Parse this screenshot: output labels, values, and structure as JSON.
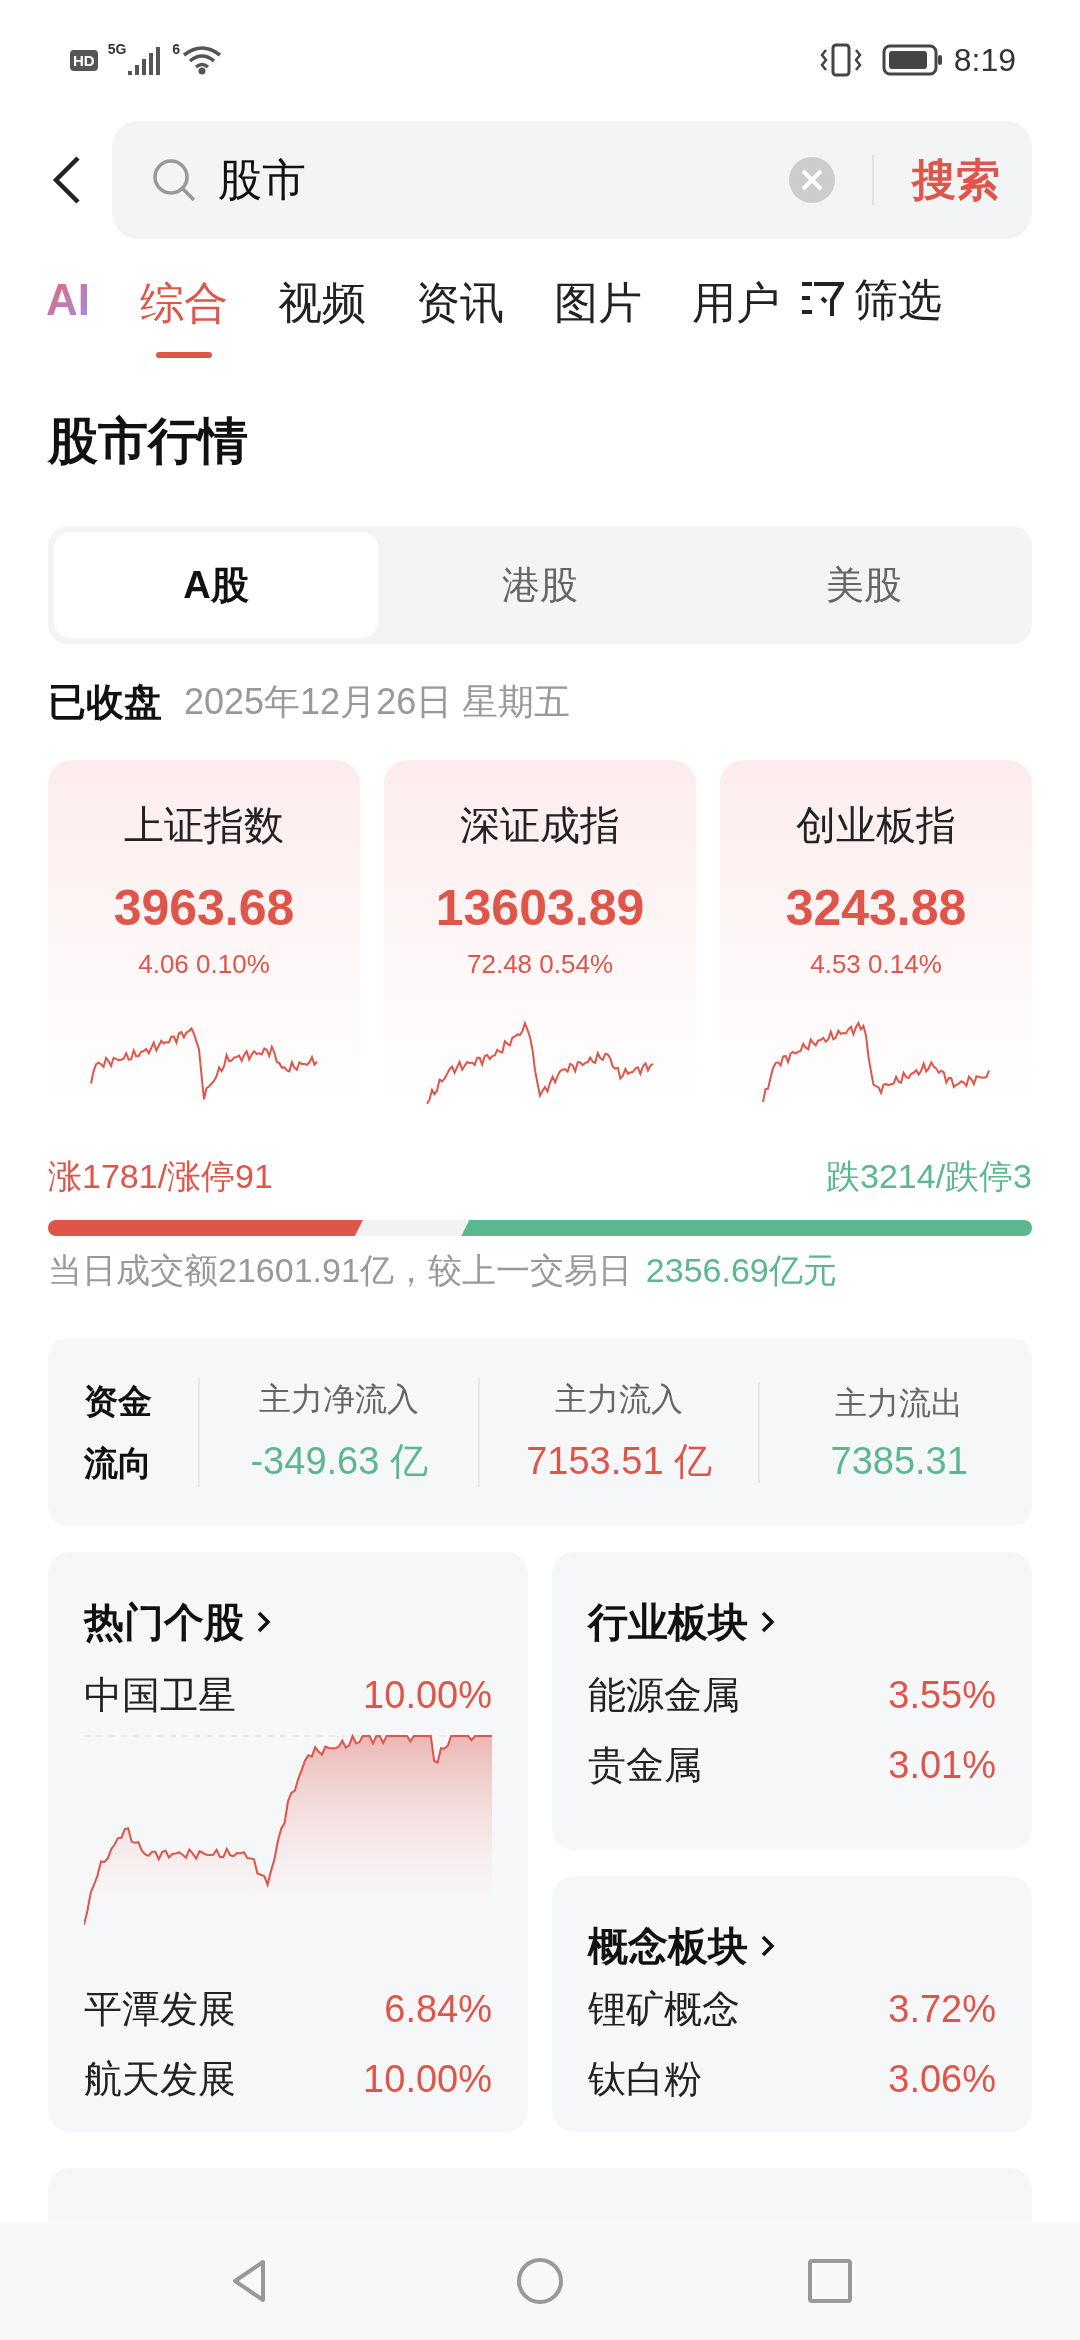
{
  "status_bar": {
    "hd": "HD",
    "network": "5G",
    "wifi_gen": "6",
    "time": "8:19"
  },
  "search": {
    "value": "股市",
    "button": "搜索"
  },
  "ai_label": "AI",
  "tabs": [
    {
      "label": "综合",
      "selected": true
    },
    {
      "label": "视频",
      "selected": false
    },
    {
      "label": "资讯",
      "selected": false
    },
    {
      "label": "图片",
      "selected": false
    },
    {
      "label": "用户",
      "selected": false
    }
  ],
  "filter": "筛选",
  "section_title": "股市行情",
  "markets": [
    {
      "label": "A股",
      "selected": true
    },
    {
      "label": "港股",
      "selected": false
    },
    {
      "label": "美股",
      "selected": false
    }
  ],
  "market_status": "已收盘",
  "date": "2025年12月26日 星期五",
  "indices": [
    {
      "name": "上证指数",
      "value": "3963.68",
      "change": "4.06 0.10%"
    },
    {
      "name": "深证成指",
      "value": "13603.89",
      "change": "72.48 0.54%"
    },
    {
      "name": "创业板指",
      "value": "3243.88",
      "change": "4.53 0.14%"
    }
  ],
  "breadth": {
    "up_text": "涨1781/涨停91",
    "down_text": "跌3214/跌停3",
    "up": {
      "level": 0.32
    },
    "down": {
      "level": 0.58
    }
  },
  "turnover": {
    "text": "当日成交额21601.91亿，较上一交易日",
    "delta": "2356.69亿元"
  },
  "fund_flow": {
    "title": "资金流向",
    "columns": [
      {
        "label": "主力净流入",
        "value": "-349.63 亿",
        "color": "#5bb88e"
      },
      {
        "label": "主力流入",
        "value": "7153.51 亿",
        "color": "#e0554a"
      },
      {
        "label": "主力流出",
        "value": "7385.31",
        "color": "#5bb88e"
      }
    ]
  },
  "hot_stocks": {
    "title": "热门个股",
    "featured": {
      "name": "中国卫星",
      "pct": "10.00%"
    },
    "items": [
      {
        "name": "平潭发展",
        "pct": "6.84%"
      },
      {
        "name": "航天发展",
        "pct": "10.00%"
      }
    ]
  },
  "industry": {
    "title": "行业板块",
    "items": [
      {
        "name": "能源金属",
        "pct": "3.55%"
      },
      {
        "name": "贵金属",
        "pct": "3.01%"
      }
    ]
  },
  "concept": {
    "title": "概念板块",
    "items": [
      {
        "name": "锂矿概念",
        "pct": "3.72%"
      },
      {
        "name": "钛白粉",
        "pct": "3.06%"
      }
    ]
  }
}
